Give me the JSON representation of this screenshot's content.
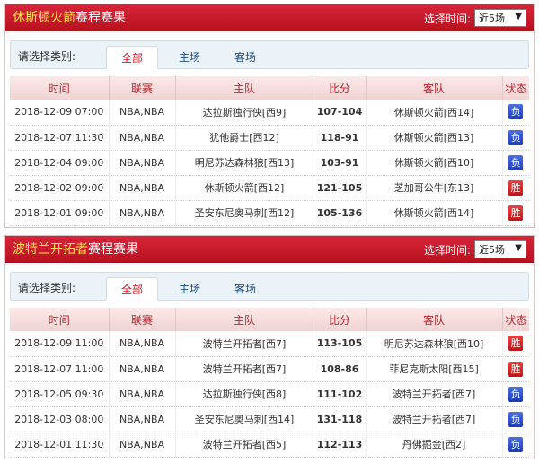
{
  "panels": [
    {
      "team": "休斯顿火箭",
      "suffix": "赛程赛果",
      "time_label": "选择时间:",
      "time_value": "近5场",
      "category_label": "请选择类别:",
      "tabs": [
        "全部",
        "主场",
        "客场"
      ],
      "columns": [
        "时间",
        "联赛",
        "主队",
        "比分",
        "客队",
        "状态"
      ],
      "rows": [
        {
          "time": "2018-12-09 07:00",
          "league": "NBA,NBA",
          "home": "达拉斯独行侠[西9]",
          "score": "107-104",
          "away": "休斯顿火箭[西14]",
          "status": "负",
          "result": "lose"
        },
        {
          "time": "2018-12-07 11:30",
          "league": "NBA,NBA",
          "home": "犹他爵士[西12]",
          "score": "118-91",
          "away": "休斯顿火箭[西13]",
          "status": "负",
          "result": "lose"
        },
        {
          "time": "2018-12-04 09:00",
          "league": "NBA,NBA",
          "home": "明尼苏达森林狼[西13]",
          "score": "103-91",
          "away": "休斯顿火箭[西10]",
          "status": "负",
          "result": "lose"
        },
        {
          "time": "2018-12-02 09:00",
          "league": "NBA,NBA",
          "home": "休斯顿火箭[西12]",
          "score": "121-105",
          "away": "芝加哥公牛[东13]",
          "status": "胜",
          "result": "win"
        },
        {
          "time": "2018-12-01 09:00",
          "league": "NBA,NBA",
          "home": "圣安东尼奥马刺[西12]",
          "score": "105-136",
          "away": "休斯顿火箭[西14]",
          "status": "胜",
          "result": "win"
        }
      ]
    },
    {
      "team": "波特兰开拓者",
      "suffix": "赛程赛果",
      "time_label": "选择时间:",
      "time_value": "近5场",
      "category_label": "请选择类别:",
      "tabs": [
        "全部",
        "主场",
        "客场"
      ],
      "columns": [
        "时间",
        "联赛",
        "主队",
        "比分",
        "客队",
        "状态"
      ],
      "rows": [
        {
          "time": "2018-12-09 11:00",
          "league": "NBA,NBA",
          "home": "波特兰开拓者[西7]",
          "score": "113-105",
          "away": "明尼苏达森林狼[西10]",
          "status": "胜",
          "result": "win"
        },
        {
          "time": "2018-12-07 11:00",
          "league": "NBA,NBA",
          "home": "波特兰开拓者[西7]",
          "score": "108-86",
          "away": "菲尼克斯太阳[西15]",
          "status": "胜",
          "result": "win"
        },
        {
          "time": "2018-12-05 09:30",
          "league": "NBA,NBA",
          "home": "达拉斯独行侠[西8]",
          "score": "111-102",
          "away": "波特兰开拓者[西7]",
          "status": "负",
          "result": "lose"
        },
        {
          "time": "2018-12-03 08:00",
          "league": "NBA,NBA",
          "home": "圣安东尼奥马刺[西14]",
          "score": "131-118",
          "away": "波特兰开拓者[西7]",
          "status": "负",
          "result": "lose"
        },
        {
          "time": "2018-12-01 11:30",
          "league": "NBA,NBA",
          "home": "波特兰开拓者[西5]",
          "score": "112-113",
          "away": "丹佛掘金[西2]",
          "status": "负",
          "result": "lose"
        }
      ]
    }
  ]
}
